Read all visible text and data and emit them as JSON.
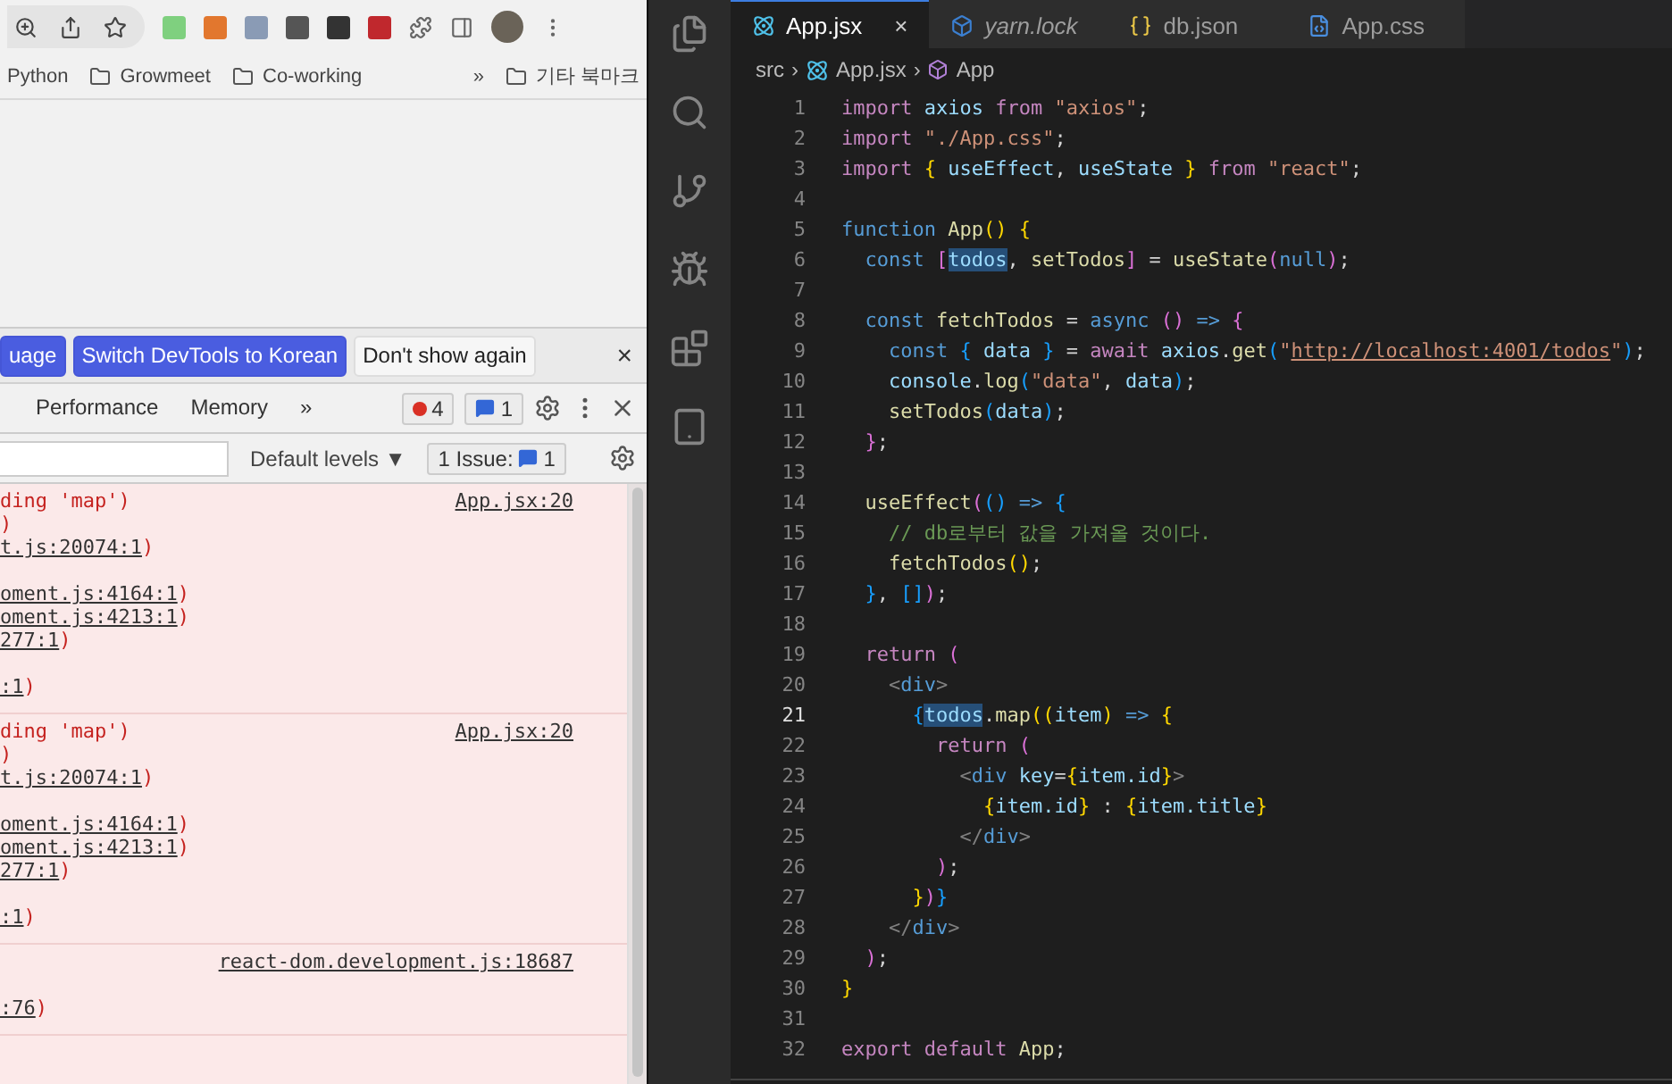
{
  "browser": {
    "bookmarks": [
      {
        "label": "Python",
        "folder": false
      },
      {
        "label": "Growmeet",
        "folder": true
      },
      {
        "label": "Co-working",
        "folder": true
      }
    ],
    "bookmarks_overflow": "»",
    "other_bookmarks": "기타 북마크"
  },
  "devtools": {
    "infobar": {
      "buttons": [
        {
          "label": "uage",
          "kind": "primary"
        },
        {
          "label": "Switch DevTools to Korean",
          "kind": "primary"
        },
        {
          "label": "Don't show again",
          "kind": "secondary"
        }
      ],
      "close": "×"
    },
    "tabs": [
      {
        "label": "Performance",
        "selected": false
      },
      {
        "label": "Memory",
        "selected": false
      }
    ],
    "tabs_overflow": "»",
    "error_count": "4",
    "message_count": "1",
    "filter": {
      "levels": "Default levels ▼",
      "issues_label": "1 Issue:",
      "issues_count": "1"
    },
    "console": [
      {
        "kind": "error",
        "message": "ding 'map')",
        "source": "App.jsx:20",
        "lines": [
          {
            "text": ")"
          },
          {
            "link": "t.js:20074:1",
            "text": ")"
          },
          {
            "link": "oment.js:4164:1",
            "text": ")",
            "gap": true
          },
          {
            "link": "oment.js:4213:1",
            "text": ")"
          },
          {
            "link": "277:1",
            "text": ")"
          },
          {
            "link": ":1",
            "text": ")",
            "gap": true
          }
        ]
      },
      {
        "kind": "error",
        "message": "ding 'map')",
        "source": "App.jsx:20",
        "lines": [
          {
            "text": ")"
          },
          {
            "link": "t.js:20074:1",
            "text": ")"
          },
          {
            "link": "oment.js:4164:1",
            "text": ")",
            "gap": true
          },
          {
            "link": "oment.js:4213:1",
            "text": ")"
          },
          {
            "link": "277:1",
            "text": ")"
          },
          {
            "link": ":1",
            "text": ")",
            "gap": true
          }
        ]
      },
      {
        "kind": "error",
        "source": "react-dom.development.js:18687",
        "lines": [
          {
            "link": ":76",
            "text": ")",
            "gap": true
          }
        ]
      }
    ]
  },
  "editor": {
    "tabs": [
      {
        "label": "App.jsx",
        "kind": "react",
        "selected": true,
        "italic": false,
        "close": "×"
      },
      {
        "label": "yarn.lock",
        "kind": "yarn",
        "selected": false,
        "italic": true
      },
      {
        "label": "db.json",
        "kind": "json",
        "selected": false,
        "italic": false
      },
      {
        "label": "App.css",
        "kind": "css",
        "selected": false,
        "italic": false
      }
    ],
    "breadcrumb": [
      {
        "label": "src",
        "kind": "folder"
      },
      {
        "label": "App.jsx",
        "kind": "react",
        "separator": "›"
      },
      {
        "label": "App",
        "kind": "symbol",
        "separator": "›"
      }
    ],
    "lines": [
      {
        "number": "1",
        "selected": false,
        "tokens": [
          {
            "kind": "k",
            "text": "import "
          },
          {
            "kind": "v",
            "text": "axios "
          },
          {
            "kind": "k",
            "text": "from "
          },
          {
            "kind": "s",
            "text": "\"axios\""
          },
          {
            "kind": "p",
            "text": ";"
          }
        ]
      },
      {
        "number": "2",
        "selected": false,
        "tokens": [
          {
            "kind": "k",
            "text": "import "
          },
          {
            "kind": "s",
            "text": "\"./App.css\""
          },
          {
            "kind": "p",
            "text": ";"
          }
        ]
      },
      {
        "number": "3",
        "selected": false,
        "tokens": [
          {
            "kind": "k",
            "text": "import "
          },
          {
            "kind": "b1",
            "text": "{ "
          },
          {
            "kind": "v",
            "text": "useEffect"
          },
          {
            "kind": "p",
            "text": ", "
          },
          {
            "kind": "v",
            "text": "useState "
          },
          {
            "kind": "b1",
            "text": "} "
          },
          {
            "kind": "k",
            "text": "from "
          },
          {
            "kind": "s",
            "text": "\"react\""
          },
          {
            "kind": "p",
            "text": ";"
          }
        ]
      },
      {
        "number": "4",
        "selected": false
      },
      {
        "number": "5",
        "selected": false,
        "tokens": [
          {
            "kind": "d",
            "text": "function "
          },
          {
            "kind": "f",
            "text": "App"
          },
          {
            "kind": "b1",
            "text": "() {"
          }
        ]
      },
      {
        "number": "6",
        "selected": false,
        "tokens": [
          {
            "kind": "d",
            "text": "  const "
          },
          {
            "kind": "b2",
            "text": "["
          },
          {
            "kind": "v",
            "text": "todos",
            "highlighted": true
          },
          {
            "kind": "p",
            "text": ", "
          },
          {
            "kind": "f",
            "text": "setTodos"
          },
          {
            "kind": "b2",
            "text": "]"
          },
          {
            "kind": "p",
            "text": " = "
          },
          {
            "kind": "f",
            "text": "useState"
          },
          {
            "kind": "b2",
            "text": "("
          },
          {
            "kind": "d",
            "text": "null"
          },
          {
            "kind": "b2",
            "text": ")"
          },
          {
            "kind": "p",
            "text": ";"
          }
        ]
      },
      {
        "number": "7",
        "selected": false
      },
      {
        "number": "8",
        "selected": false,
        "tokens": [
          {
            "kind": "d",
            "text": "  const "
          },
          {
            "kind": "f",
            "text": "fetchTodos"
          },
          {
            "kind": "p",
            "text": " = "
          },
          {
            "kind": "d",
            "text": "async "
          },
          {
            "kind": "b2",
            "text": "() "
          },
          {
            "kind": "d",
            "text": "=> "
          },
          {
            "kind": "b2",
            "text": "{"
          }
        ]
      },
      {
        "number": "9",
        "selected": false,
        "tokens": [
          {
            "kind": "d",
            "text": "    const "
          },
          {
            "kind": "b3",
            "text": "{ "
          },
          {
            "kind": "v",
            "text": "data "
          },
          {
            "kind": "b3",
            "text": "} "
          },
          {
            "kind": "p",
            "text": "= "
          },
          {
            "kind": "k",
            "text": "await "
          },
          {
            "kind": "v",
            "text": "axios"
          },
          {
            "kind": "p",
            "text": "."
          },
          {
            "kind": "f",
            "text": "get"
          },
          {
            "kind": "b3",
            "text": "("
          },
          {
            "kind": "s",
            "text": "\""
          },
          {
            "kind": "u",
            "text": "http://localhost:4001/todos"
          },
          {
            "kind": "s",
            "text": "\""
          },
          {
            "kind": "b3",
            "text": ")"
          },
          {
            "kind": "p",
            "text": ";"
          }
        ]
      },
      {
        "number": "10",
        "selected": false,
        "tokens": [
          {
            "kind": "v",
            "text": "    console"
          },
          {
            "kind": "p",
            "text": "."
          },
          {
            "kind": "f",
            "text": "log"
          },
          {
            "kind": "b3",
            "text": "("
          },
          {
            "kind": "s",
            "text": "\"data\""
          },
          {
            "kind": "p",
            "text": ", "
          },
          {
            "kind": "v",
            "text": "data"
          },
          {
            "kind": "b3",
            "text": ")"
          },
          {
            "kind": "p",
            "text": ";"
          }
        ]
      },
      {
        "number": "11",
        "selected": false,
        "tokens": [
          {
            "kind": "f",
            "text": "    setTodos"
          },
          {
            "kind": "b3",
            "text": "("
          },
          {
            "kind": "v",
            "text": "data"
          },
          {
            "kind": "b3",
            "text": ")"
          },
          {
            "kind": "p",
            "text": ";"
          }
        ]
      },
      {
        "number": "12",
        "selected": false,
        "tokens": [
          {
            "kind": "b2",
            "text": "  }"
          },
          {
            "kind": "p",
            "text": ";"
          }
        ]
      },
      {
        "number": "13",
        "selected": false
      },
      {
        "number": "14",
        "selected": false,
        "tokens": [
          {
            "kind": "f",
            "text": "  useEffect"
          },
          {
            "kind": "b2",
            "text": "("
          },
          {
            "kind": "b3",
            "text": "() "
          },
          {
            "kind": "d",
            "text": "=> "
          },
          {
            "kind": "b3",
            "text": "{"
          }
        ]
      },
      {
        "number": "15",
        "selected": false,
        "tokens": [
          {
            "kind": "c",
            "text": "    // db로부터 값을 가져올 것이다."
          }
        ]
      },
      {
        "number": "16",
        "selected": false,
        "tokens": [
          {
            "kind": "f",
            "text": "    fetchTodos"
          },
          {
            "kind": "b1",
            "text": "()"
          },
          {
            "kind": "p",
            "text": ";"
          }
        ]
      },
      {
        "number": "17",
        "selected": false,
        "tokens": [
          {
            "kind": "b3",
            "text": "  }"
          },
          {
            "kind": "p",
            "text": ", "
          },
          {
            "kind": "b3",
            "text": "[]"
          },
          {
            "kind": "b2",
            "text": ")"
          },
          {
            "kind": "p",
            "text": ";"
          }
        ]
      },
      {
        "number": "18",
        "selected": false
      },
      {
        "number": "19",
        "selected": false,
        "tokens": [
          {
            "kind": "k",
            "text": "  return "
          },
          {
            "kind": "b2",
            "text": "("
          }
        ]
      },
      {
        "number": "20",
        "selected": false,
        "tokens": [
          {
            "kind": "t",
            "text": "    <"
          },
          {
            "kind": "n",
            "text": "div"
          },
          {
            "kind": "t",
            "text": ">"
          }
        ]
      },
      {
        "number": "21",
        "selected": true,
        "tokens": [
          {
            "kind": "b3",
            "text": "      {"
          },
          {
            "kind": "v",
            "text": "todos",
            "highlighted": true
          },
          {
            "kind": "p",
            "text": "."
          },
          {
            "kind": "f",
            "text": "map"
          },
          {
            "kind": "b1",
            "text": "(("
          },
          {
            "kind": "v",
            "text": "item"
          },
          {
            "kind": "b1",
            "text": ") "
          },
          {
            "kind": "d",
            "text": "=> "
          },
          {
            "kind": "b1",
            "text": "{"
          }
        ]
      },
      {
        "number": "22",
        "selected": false,
        "tokens": [
          {
            "kind": "k",
            "text": "        return "
          },
          {
            "kind": "b2",
            "text": "("
          }
        ]
      },
      {
        "number": "23",
        "selected": false,
        "tokens": [
          {
            "kind": "t",
            "text": "          <"
          },
          {
            "kind": "n",
            "text": "div "
          },
          {
            "kind": "v",
            "text": "key"
          },
          {
            "kind": "p",
            "text": "="
          },
          {
            "kind": "b1",
            "text": "{"
          },
          {
            "kind": "v",
            "text": "item.id"
          },
          {
            "kind": "b1",
            "text": "}"
          },
          {
            "kind": "t",
            "text": ">"
          }
        ]
      },
      {
        "number": "24",
        "selected": false,
        "tokens": [
          {
            "kind": "b1",
            "text": "            {"
          },
          {
            "kind": "v",
            "text": "item.id"
          },
          {
            "kind": "b1",
            "text": "} "
          },
          {
            "kind": "p",
            "text": ": "
          },
          {
            "kind": "b1",
            "text": "{"
          },
          {
            "kind": "v",
            "text": "item.title"
          },
          {
            "kind": "b1",
            "text": "}"
          }
        ]
      },
      {
        "number": "25",
        "selected": false,
        "tokens": [
          {
            "kind": "t",
            "text": "          </"
          },
          {
            "kind": "n",
            "text": "div"
          },
          {
            "kind": "t",
            "text": ">"
          }
        ]
      },
      {
        "number": "26",
        "selected": false,
        "tokens": [
          {
            "kind": "b2",
            "text": "        )"
          },
          {
            "kind": "p",
            "text": ";"
          }
        ]
      },
      {
        "number": "27",
        "selected": false,
        "tokens": [
          {
            "kind": "b1",
            "text": "      }"
          },
          {
            "kind": "b2",
            "text": ")"
          },
          {
            "kind": "b3",
            "text": "}"
          }
        ]
      },
      {
        "number": "28",
        "selected": false,
        "tokens": [
          {
            "kind": "t",
            "text": "    </"
          },
          {
            "kind": "n",
            "text": "div"
          },
          {
            "kind": "t",
            "text": ">"
          }
        ]
      },
      {
        "number": "29",
        "selected": false,
        "tokens": [
          {
            "kind": "b2",
            "text": "  )"
          },
          {
            "kind": "p",
            "text": ";"
          }
        ]
      },
      {
        "number": "30",
        "selected": false,
        "tokens": [
          {
            "kind": "b1",
            "text": "}"
          }
        ]
      },
      {
        "number": "31",
        "selected": false
      },
      {
        "number": "32",
        "selected": false,
        "tokens": [
          {
            "kind": "k",
            "text": "export default "
          },
          {
            "kind": "f",
            "text": "App"
          },
          {
            "kind": "p",
            "text": ";"
          }
        ]
      }
    ]
  }
}
